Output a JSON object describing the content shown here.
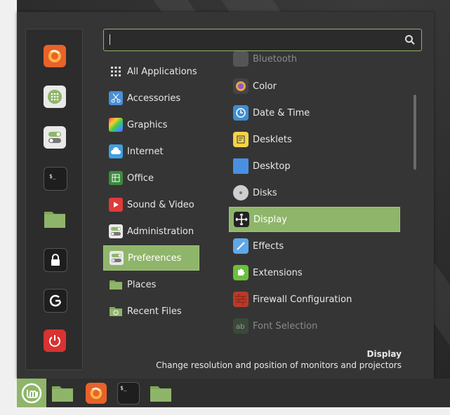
{
  "search": {
    "placeholder": "",
    "value": ""
  },
  "favorites": [
    {
      "name": "firefox-icon",
      "color": "#e8622b"
    },
    {
      "name": "software-manager-icon",
      "color": "#e9e9e9"
    },
    {
      "name": "system-settings-icon",
      "color": "#e9e9e9"
    },
    {
      "name": "terminal-icon",
      "color": "#1e1e1e"
    },
    {
      "name": "files-folder-icon",
      "color": "#8fb56a"
    },
    {
      "name": "lock-screen-icon",
      "color": "#1e1e1e"
    },
    {
      "name": "logout-icon",
      "color": "#1e1e1e"
    },
    {
      "name": "shutdown-icon",
      "color": "#d93232"
    }
  ],
  "categories": [
    {
      "label": "All Applications",
      "icon": "grid-icon"
    },
    {
      "label": "Accessories",
      "icon": "scissors-icon"
    },
    {
      "label": "Graphics",
      "icon": "palette-icon"
    },
    {
      "label": "Internet",
      "icon": "cloud-icon"
    },
    {
      "label": "Office",
      "icon": "spreadsheet-icon"
    },
    {
      "label": "Sound & Video",
      "icon": "play-icon"
    },
    {
      "label": "Administration",
      "icon": "toggle-icon"
    },
    {
      "label": "Preferences",
      "icon": "toggle-icon",
      "selected": true
    },
    {
      "label": "Places",
      "icon": "folder-icon"
    },
    {
      "label": "Recent Files",
      "icon": "recent-folder-icon"
    }
  ],
  "apps": [
    {
      "label": "Bluetooth",
      "icon": "bluetooth-icon",
      "dim": true
    },
    {
      "label": "Color",
      "icon": "color-icon"
    },
    {
      "label": "Date & Time",
      "icon": "clock-icon"
    },
    {
      "label": "Desklets",
      "icon": "desklets-icon"
    },
    {
      "label": "Desktop",
      "icon": "desktop-icon"
    },
    {
      "label": "Disks",
      "icon": "disk-icon"
    },
    {
      "label": "Display",
      "icon": "display-icon",
      "selected": true
    },
    {
      "label": "Effects",
      "icon": "effects-icon"
    },
    {
      "label": "Extensions",
      "icon": "puzzle-icon"
    },
    {
      "label": "Firewall Configuration",
      "icon": "firewall-icon"
    },
    {
      "label": "Font Selection",
      "icon": "font-icon",
      "dim": true
    }
  ],
  "description": {
    "title": "Display",
    "text": "Change resolution and position of monitors and projectors"
  },
  "panel": {
    "items": [
      {
        "name": "panel-files-icon"
      },
      {
        "name": "panel-firefox-icon"
      },
      {
        "name": "panel-terminal-icon"
      },
      {
        "name": "panel-folder-icon"
      }
    ]
  },
  "colors": {
    "accent": "#8fb56a",
    "menu_bg": "#353535",
    "panel_bg": "#2f2f2f",
    "text": "#e8e8e8"
  }
}
